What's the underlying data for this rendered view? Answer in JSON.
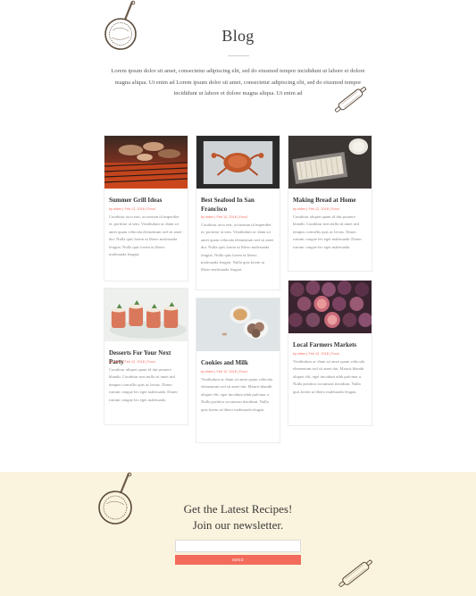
{
  "hero": {
    "title": "Blog",
    "intro": "Lorem ipsum dolor sit amet, consectetur adipiscing elit, sed do eiusmod tempor incididunt ut labore et dolore magna aliqua. Ut enim ad Lorem ipsum dolor sit amet, consectetur adipiscing elit, sed do eiusmod tempor incididunt ut labore et dolore magna aliqua. Ut enim ad"
  },
  "posts": [
    {
      "title": "Summer Grill Ideas",
      "meta": "by elden | Feb 12, 2018 | Food",
      "excerpt": "Curabitur arcu erat, accumsan id imperdiet et, porttitor at sem. Vestibulum ac diam sit amet quam vehicula elementum sed sit amet dui. Nulla quis lorem ut libero malesuada feugiat. Nulla quis lorem ut libero malesuada feugiat.",
      "image": "grill-photo"
    },
    {
      "title": "Best Seafood In San Francisco",
      "meta": "by elden | Feb 12, 2018 | Food",
      "excerpt": "Curabitur arcu erat, accumsan id imperdiet et, porttitor at sem. Vestibulum ac diam sit amet quam vehicula elementum sed sit amet dui. Nulla quis lorem ut libero malesuada feugiat. Nulla quis lorem ut libero malesuada feugiat. Nulla quis lorem ut libero malesuada feugiat.",
      "image": "crab-photo"
    },
    {
      "title": "Making Bread at Home",
      "meta": "by elden | Feb 12, 2018 | Food",
      "excerpt": "Curabitur aliquet quam id dui posuere blandit. Curabitur non nulla sit amet nisl tempus convallis quis ac lectus. Donec rutrum congue leo eget malesuada. Donec rutrum congue leo eget malesuada.",
      "image": "bread-photo"
    },
    {
      "title": "Desserts For Your Next Party",
      "meta": "by elden | Feb 12, 2018 | Food",
      "excerpt": "Curabitur aliquet quam id dui posuere blandit. Curabitur non nulla sit amet nisl tempus convallis quis ac lectus. Donec rutrum congue leo eget malesuada. Donec rutrum congue leo eget malesuada.",
      "image": "dessert-photo"
    },
    {
      "title": "Cookies and Milk",
      "meta": "by elden | Feb 12, 2018 | Food",
      "excerpt": "Vestibulum ac diam sit amet quam vehicula elementum sed sit amet dui. Mauris blandit aliquet elit, eget tincidunt nibh pulvinar a. Nulla porttitor accumsan tincidunt. Nulla quis lorem ut libero malesuada feugiat.",
      "image": "cookies-photo"
    },
    {
      "title": "Local Farmers Markets",
      "meta": "by elden | Feb 12, 2018 | Food",
      "excerpt": "Vestibulum ac diam sit amet quam vehicula elementum sed sit amet dui. Mauris blandit aliquet elit, eget tincidunt nibh pulvinar a. Nulla porttitor accumsan tincidunt. Nulla quis lorem ut libero malesuada feugiat.",
      "image": "figs-photo"
    }
  ],
  "newsletter": {
    "heading_line1": "Get the Latest Recipes!",
    "heading_line2": "Join our newsletter.",
    "email_placeholder": "",
    "button_label": "SEND"
  },
  "colors": {
    "accent": "#f26b5b",
    "newsletter_bg": "#faf3dd"
  }
}
